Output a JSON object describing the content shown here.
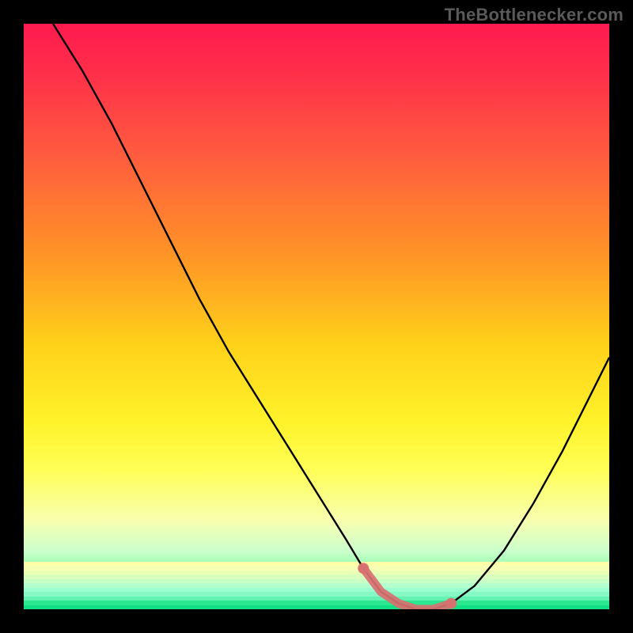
{
  "watermark": "TheBottlenecker.com",
  "chart_data": {
    "type": "line",
    "title": "",
    "xlabel": "",
    "ylabel": "",
    "xlim": [
      0,
      100
    ],
    "ylim": [
      0,
      100
    ],
    "curve_x": [
      5,
      10,
      15,
      20,
      25,
      30,
      35,
      40,
      45,
      50,
      55,
      58,
      61,
      64,
      67,
      70,
      73,
      77,
      82,
      87,
      92,
      97,
      100
    ],
    "curve_y": [
      100,
      92,
      83,
      73,
      63,
      53,
      44,
      36,
      28,
      20,
      12,
      7,
      3,
      1,
      0,
      0,
      1,
      4,
      10,
      18,
      27,
      37,
      43
    ],
    "sweet_spot_x": [
      58,
      61,
      64,
      67,
      70,
      73
    ],
    "sweet_spot_y": [
      7,
      3,
      1,
      0,
      0,
      1
    ],
    "colors": {
      "curve": "#000000",
      "sweet_spot": "#d97070",
      "gradient_top": "#ff1a4f",
      "gradient_bottom": "#11df86",
      "background": "#000000"
    }
  }
}
